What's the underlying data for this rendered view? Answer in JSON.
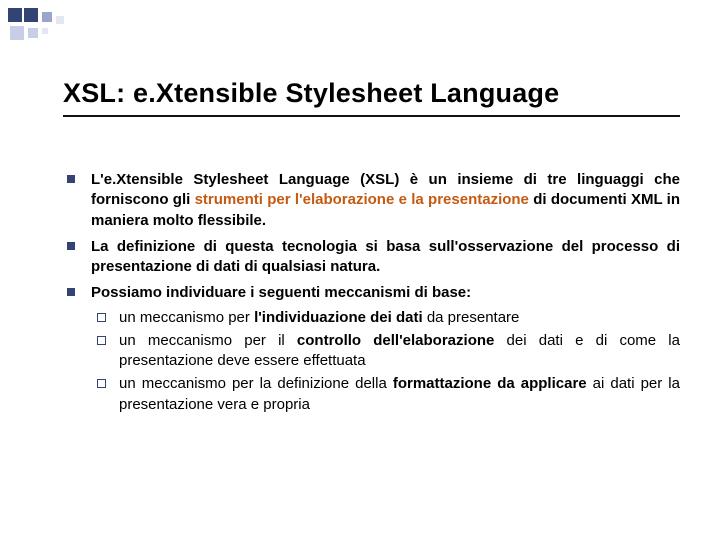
{
  "title": "XSL: e.Xtensible Stylesheet Language",
  "bullet1": {
    "pre": "L'",
    "bold1": "e.Xtensible Stylesheet Language (XSL)",
    "mid1": " è un insieme di tre linguaggi che forniscono gli ",
    "accent1": "strumenti per l'elaborazione e la presentazione",
    "post1": " di documenti XML in maniera molto flessibile."
  },
  "bullet2": "La definizione di questa tecnologia si basa sull'osservazione del processo di  presentazione di dati di qualsiasi natura.",
  "bullet3": "Possiamo individuare i seguenti meccanismi di base:",
  "sub1": {
    "pre": "un meccanismo per ",
    "bold": "l'individuazione dei dati",
    "post": " da presentare"
  },
  "sub2": {
    "pre": "un meccanismo per il ",
    "bold": "controllo dell'elaborazione",
    "post": " dei dati e di come la presentazione deve essere effettuata"
  },
  "sub3": {
    "pre": "un meccanismo per la definizione della ",
    "bold": "formattazione da applicare",
    "post": " ai dati per la presentazione vera e propria"
  }
}
